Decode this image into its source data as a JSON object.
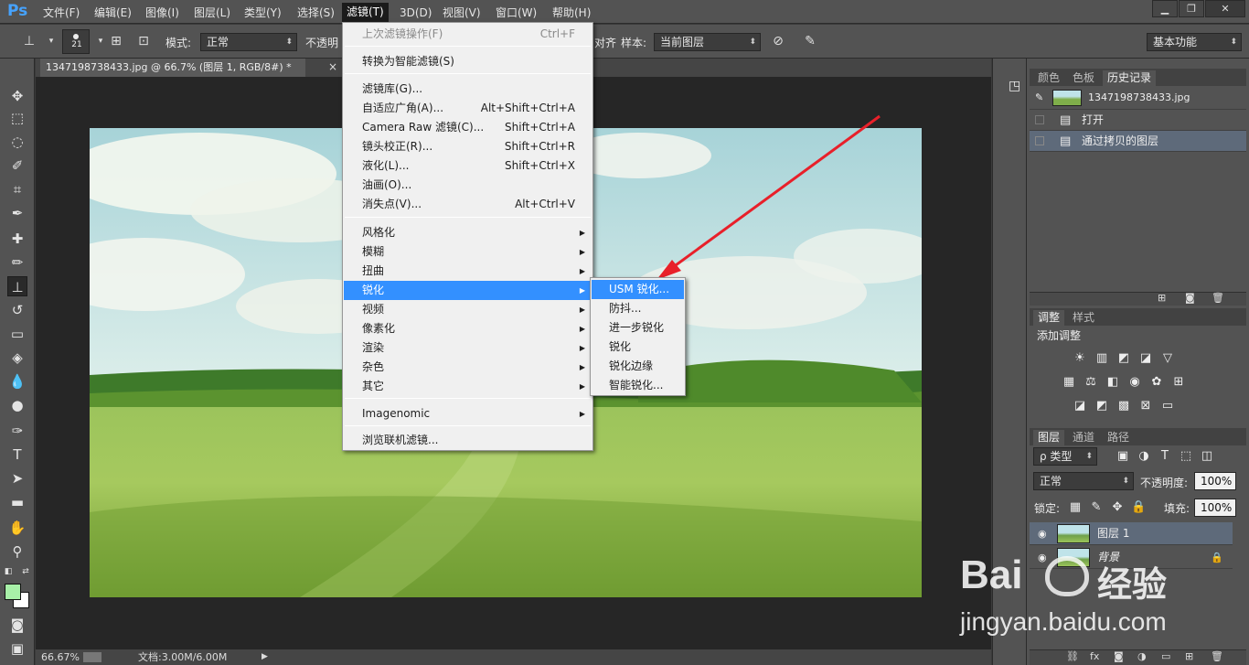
{
  "menubar": {
    "logo": "Ps",
    "items": [
      "文件(F)",
      "编辑(E)",
      "图像(I)",
      "图层(L)",
      "类型(Y)",
      "选择(S)",
      "滤镜(T)",
      "3D(D)",
      "视图(V)",
      "窗口(W)",
      "帮助(H)"
    ],
    "active_index": 6
  },
  "window_buttons": {
    "minimize": "▁",
    "restore": "❐",
    "close": "✕"
  },
  "options": {
    "brush_size": "21",
    "mode_label": "模式:",
    "mode_value": "正常",
    "opacity_label": "不透明",
    "align_label": "对齐",
    "sample_label": "样本:",
    "sample_value": "当前图层",
    "workspace_value": "基本功能"
  },
  "document": {
    "tab_title": "1347198738433.jpg @ 66.7% (图层 1, RGB/8#) *",
    "tab_close": "×",
    "zoom": "66.67%",
    "doc_info": "文档:3.00M/6.00M"
  },
  "filter_menu": {
    "items": [
      {
        "label": "上次滤镜操作(F)",
        "shortcut": "Ctrl+F",
        "disabled": true
      },
      {
        "label": "转换为智能滤镜(S)"
      },
      {
        "label": "滤镜库(G)..."
      },
      {
        "label": "自适应广角(A)...",
        "shortcut": "Alt+Shift+Ctrl+A"
      },
      {
        "label": "Camera Raw 滤镜(C)...",
        "shortcut": "Shift+Ctrl+A"
      },
      {
        "label": "镜头校正(R)...",
        "shortcut": "Shift+Ctrl+R"
      },
      {
        "label": "液化(L)...",
        "shortcut": "Shift+Ctrl+X"
      },
      {
        "label": "油画(O)..."
      },
      {
        "label": "消失点(V)...",
        "shortcut": "Alt+Ctrl+V"
      },
      {
        "label": "风格化"
      },
      {
        "label": "模糊"
      },
      {
        "label": "扭曲"
      },
      {
        "label": "锐化",
        "highlight": true
      },
      {
        "label": "视频"
      },
      {
        "label": "像素化"
      },
      {
        "label": "渲染"
      },
      {
        "label": "杂色"
      },
      {
        "label": "其它"
      },
      {
        "label": "Imagenomic"
      },
      {
        "label": "浏览联机滤镜..."
      }
    ]
  },
  "sharpen_submenu": {
    "items": [
      "USM 锐化...",
      "防抖...",
      "进一步锐化",
      "锐化",
      "锐化边缘",
      "智能锐化..."
    ],
    "highlight_index": 0
  },
  "history_panel": {
    "tabs": [
      "颜色",
      "色板",
      "历史记录"
    ],
    "active_tab": 2,
    "snapshot": "1347198738433.jpg",
    "states": [
      "打开",
      "通过拷贝的图层"
    ],
    "selected_state": 1
  },
  "adjustments_panel": {
    "tabs": [
      "调整",
      "样式"
    ],
    "title": "添加调整"
  },
  "layers_panel": {
    "tabs": [
      "图层",
      "通道",
      "路径"
    ],
    "filter_value": "ρ 类型",
    "blend_mode": "正常",
    "opacity_label": "不透明度:",
    "opacity_value": "100%",
    "lock_label": "锁定:",
    "fill_label": "填充:",
    "fill_value": "100%",
    "layers": [
      {
        "name": "图层 1",
        "selected": true,
        "locked": false
      },
      {
        "name": "背景",
        "selected": false,
        "locked": true
      }
    ]
  },
  "watermark": {
    "brand_left": "Bai",
    "brand_right": "经验",
    "url": "jingyan.baidu.com"
  },
  "colors": {
    "foreground": "#a8f0a8",
    "background": "#ffffff",
    "highlight": "#3390ff",
    "arrow": "#e8202a"
  }
}
